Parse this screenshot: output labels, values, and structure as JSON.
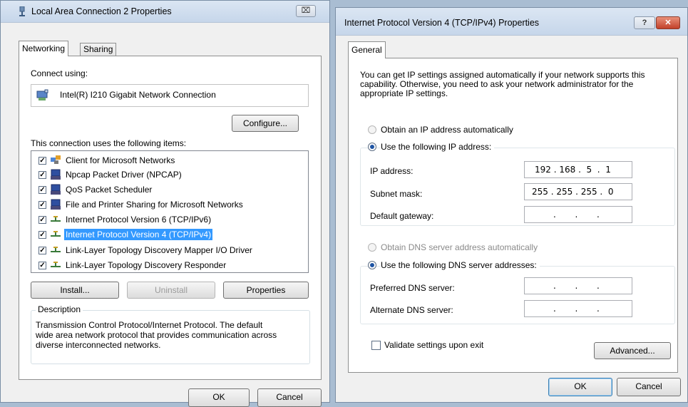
{
  "left_dialog": {
    "title": "Local Area Connection 2 Properties",
    "close_symbol": "⌧",
    "tabs": [
      {
        "label": "Networking"
      },
      {
        "label": "Sharing"
      }
    ],
    "connect_using_label": "Connect using:",
    "adapter_name": "Intel(R) I210 Gigabit Network Connection",
    "configure_label": "Configure...",
    "items_label": "This connection uses the following items:",
    "items": [
      {
        "label": "Client for Microsoft Networks",
        "checked": "✓",
        "icon": "network-client-icon"
      },
      {
        "label": "Npcap Packet Driver (NPCAP)",
        "checked": "✓",
        "icon": "service-icon"
      },
      {
        "label": "QoS Packet Scheduler",
        "checked": "✓",
        "icon": "service-icon"
      },
      {
        "label": "File and Printer Sharing for Microsoft Networks",
        "checked": "✓",
        "icon": "service-icon"
      },
      {
        "label": "Internet Protocol Version 6 (TCP/IPv6)",
        "checked": "✓",
        "icon": "protocol-icon"
      },
      {
        "label": "Internet Protocol Version 4 (TCP/IPv4)",
        "checked": "✓",
        "icon": "protocol-icon"
      },
      {
        "label": "Link-Layer Topology Discovery Mapper I/O Driver",
        "checked": "✓",
        "icon": "protocol-icon"
      },
      {
        "label": "Link-Layer Topology Discovery Responder",
        "checked": "✓",
        "icon": "protocol-icon"
      }
    ],
    "install_label": "Install...",
    "uninstall_label": "Uninstall",
    "properties_label": "Properties",
    "description_title": "Description",
    "description_text": "Transmission Control Protocol/Internet Protocol. The default wide area network protocol that provides communication across diverse interconnected networks.",
    "ok_label": "OK",
    "cancel_label": "Cancel"
  },
  "right_dialog": {
    "title": "Internet Protocol Version 4 (TCP/IPv4) Properties",
    "help_symbol": "?",
    "close_symbol": "✕",
    "tab_label": "General",
    "intro_text": "You can get IP settings assigned automatically if your network supports this capability. Otherwise, you need to ask your network administrator for the appropriate IP settings.",
    "obtain_ip_label": "Obtain an IP address automatically",
    "use_ip_label": "Use the following IP address:",
    "ip_address_label": "IP address:",
    "ip_address_value": "192 . 168 .  5  .  1",
    "subnet_label": "Subnet mask:",
    "subnet_value": "255 . 255 . 255 .  0",
    "gateway_label": "Default gateway:",
    "gateway_value": ".       .       .",
    "obtain_dns_label": "Obtain DNS server address automatically",
    "use_dns_label": "Use the following DNS server addresses:",
    "preferred_dns_label": "Preferred DNS server:",
    "preferred_dns_value": ".       .       .",
    "alternate_dns_label": "Alternate DNS server:",
    "alternate_dns_value": ".       .       .",
    "validate_label": "Validate settings upon exit",
    "advanced_label": "Advanced...",
    "ok_label": "OK",
    "cancel_label": "Cancel"
  }
}
